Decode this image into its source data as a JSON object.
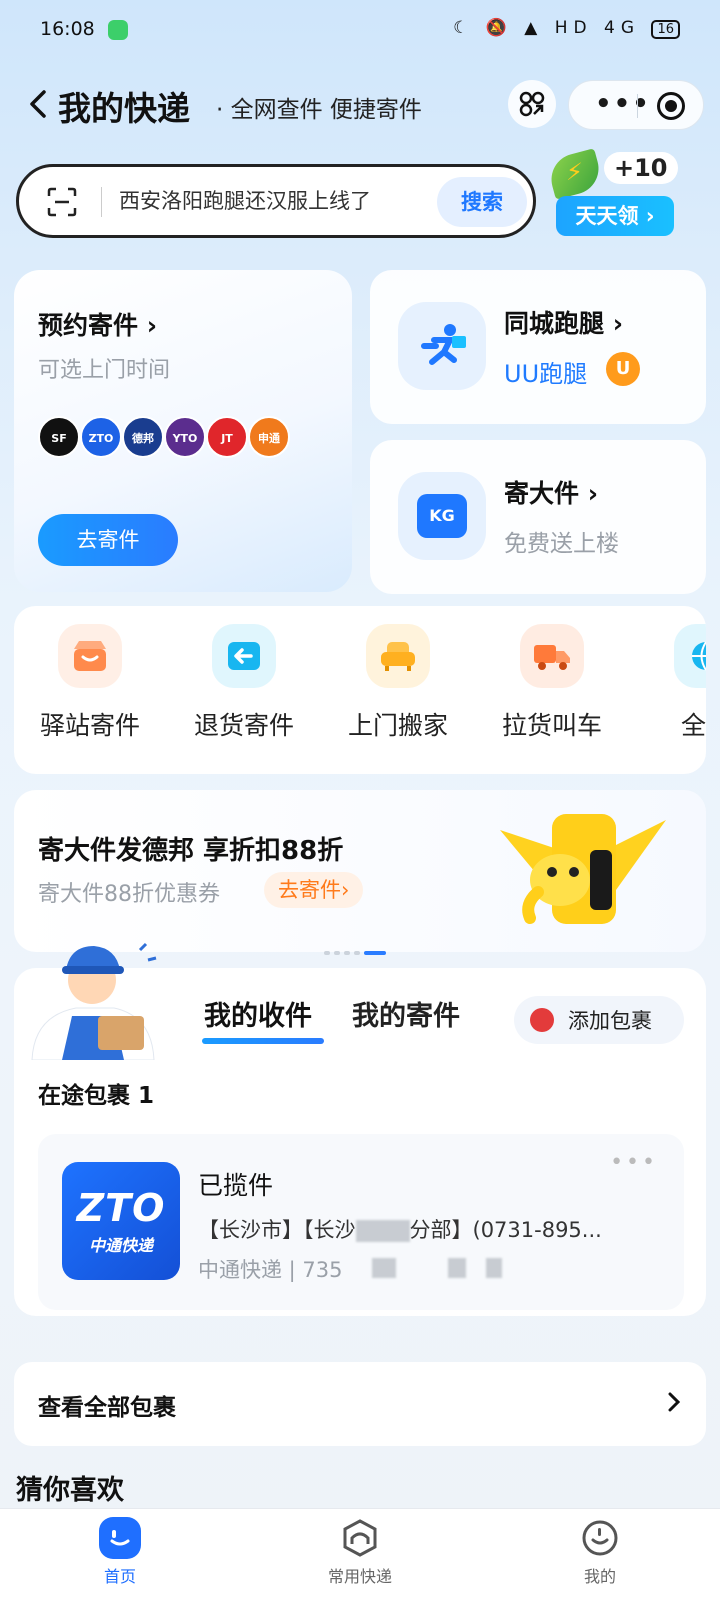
{
  "status_bar": {
    "time": "16:08",
    "icons_text": "☾ 🔕 ▲ HD 4G",
    "battery": "16"
  },
  "header": {
    "title": "我的快递",
    "subtitle": "· 全网查件 便捷寄件"
  },
  "search": {
    "placeholder_text": "西安洛阳跑腿还汉服上线了",
    "button": "搜索"
  },
  "reward": {
    "plus": "+10",
    "button": "天天领 ›"
  },
  "book_card": {
    "title": "预约寄件 ›",
    "subtitle": "可选上门时间",
    "carriers": [
      "SF",
      "ZTO",
      "德邦",
      "YTO",
      "JT",
      "申通"
    ],
    "button": "去寄件"
  },
  "errand_card": {
    "title": "同城跑腿 ›",
    "brand": "UU跑腿",
    "badge": "U"
  },
  "bulky_card": {
    "title": "寄大件 ›",
    "subtitle": "免费送上楼",
    "icon_text": "KG"
  },
  "services": [
    {
      "label": "驿站寄件",
      "icon": "store-icon",
      "color": "#ff8a4c"
    },
    {
      "label": "退货寄件",
      "icon": "return-icon",
      "color": "#18b6f0"
    },
    {
      "label": "上门搬家",
      "icon": "sofa-icon",
      "color": "#ffb020"
    },
    {
      "label": "拉货叫车",
      "icon": "truck-icon",
      "color": "#ff7a3a"
    },
    {
      "label": "全球",
      "icon": "globe-icon",
      "color": "#18b6f0"
    }
  ],
  "banner": {
    "title": "寄大件发德邦  享折扣88折",
    "subtitle": "寄大件88折优惠券",
    "button": "去寄件›"
  },
  "packages": {
    "tab_receive": "我的收件",
    "tab_send": "我的寄件",
    "add_button": "添加包裹",
    "in_transit": "在途包裹 1",
    "item": {
      "logo_big": "ZTO",
      "logo_small": "中通快递",
      "status": "已揽件",
      "route": "【长沙市】【长沙",
      "route_tail": "分部】(0731-895...",
      "company": "中通快递 | 735",
      "more": "•••"
    }
  },
  "view_all": {
    "label": "查看全部包裹"
  },
  "guess": {
    "title": "猜你喜欢"
  },
  "bottom_nav": {
    "items": [
      {
        "label": "首页",
        "active": true
      },
      {
        "label": "常用快递",
        "active": false
      },
      {
        "label": "我的",
        "active": false
      }
    ]
  },
  "colors": {
    "accent": "#1f78ff",
    "orange": "#ff7a1a"
  }
}
